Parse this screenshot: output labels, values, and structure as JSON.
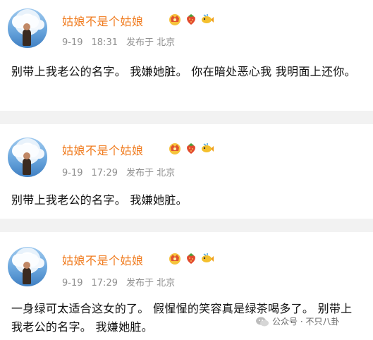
{
  "posts": [
    {
      "username": "姑娘不是个姑娘",
      "date": "9-19",
      "time": "18:31",
      "location": "发布于 北京",
      "content": "别带上我老公的名字。  我嫌她脏。 你在暗处恶心我  我明面上还你。"
    },
    {
      "username": "姑娘不是个姑娘",
      "date": "9-19",
      "time": "17:29",
      "location": "发布于 北京",
      "content": "别带上我老公的名字。  我嫌她脏。"
    },
    {
      "username": "姑娘不是个姑娘",
      "date": "9-19",
      "time": "17:29",
      "location": "发布于 北京",
      "content": "一身绿可太适合这女的了。 假惺惺的笑容真是绿茶喝多了。  别带上我老公的名字。 我嫌她脏。"
    }
  ],
  "badge_icons": [
    "crown-badge-icon",
    "strawberry-badge-icon",
    "fish-badge-icon"
  ],
  "watermark": {
    "icon": "wechat-icon",
    "text": "公众号 · 不只八卦"
  },
  "colors": {
    "username": "#f07b1e",
    "meta": "#8f8f8f",
    "background": "#f2f2f2",
    "card": "#ffffff"
  }
}
